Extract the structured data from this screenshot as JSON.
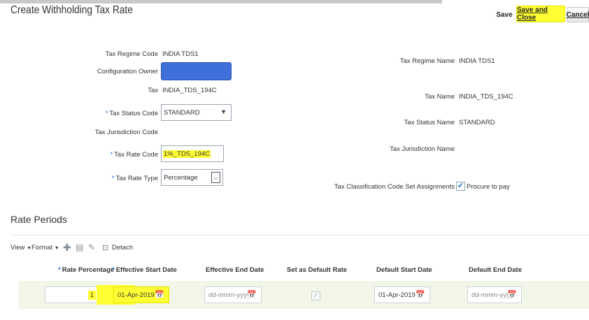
{
  "header": {
    "title": "Create Withholding Tax Rate",
    "buttons": {
      "save": "Save",
      "save_and_close": "Save and Close",
      "cancel": "Cancel"
    }
  },
  "form_left": {
    "tax_regime_code": {
      "label": "Tax Regime Code",
      "value": "INDIA TDS1"
    },
    "configuration_owner": {
      "label": "Configuration Owner",
      "value": ""
    },
    "tax": {
      "label": "Tax",
      "value": "INDIA_TDS_194C"
    },
    "tax_status_code": {
      "label": "Tax Status Code",
      "value": "STANDARD"
    },
    "tax_jurisdiction_code": {
      "label": "Tax Jurisdiction Code",
      "value": ""
    },
    "tax_rate_code": {
      "label": "Tax Rate Code",
      "value": "1%_TDS_194C"
    },
    "tax_rate_type": {
      "label": "Tax Rate Type",
      "value": "Percentage"
    }
  },
  "form_right": {
    "tax_regime_name": {
      "label": "Tax Regime Name",
      "value": "INDIA TDS1"
    },
    "tax_name": {
      "label": "Tax Name",
      "value": "INDIA_TDS_194C"
    },
    "tax_status_name": {
      "label": "Tax Status Name",
      "value": "STANDARD"
    },
    "tax_jurisdiction_name": {
      "label": "Tax Jurisdiction Name",
      "value": ""
    },
    "classification": {
      "label": "Tax Classification Code Set Assignments",
      "value": "Procure to pay",
      "checked": true
    }
  },
  "rate_periods": {
    "title": "Rate Periods",
    "toolbar": {
      "view": "View",
      "format": "Format",
      "detach": "Detach"
    },
    "columns": [
      "Rate Percentage",
      "Effective Start Date",
      "Effective End Date",
      "Set as Default Rate",
      "Default Start Date",
      "Default End Date"
    ],
    "row": {
      "rate_percentage": "1",
      "effective_start_date": "01-Apr-2019",
      "effective_end_date_placeholder": "dd-mmm-yyyy",
      "default_start_date": "01-Apr-2019",
      "default_end_date_placeholder": "dd-mmm-yyyy"
    }
  },
  "colors": {
    "highlight": "#ffff33",
    "owner_field": "#3f6fd8",
    "required": "#1a6fcf",
    "row_bg": "#f2f6e9"
  }
}
